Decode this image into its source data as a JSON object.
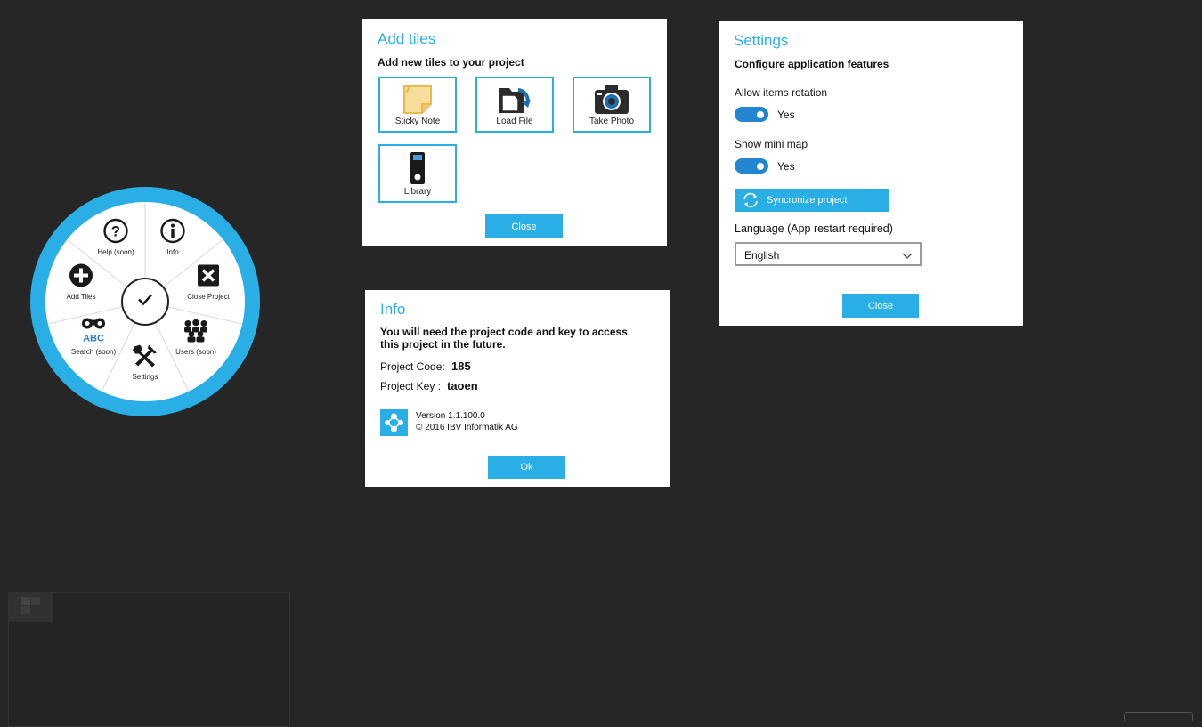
{
  "add_tiles": {
    "title": "Add tiles",
    "subtitle": "Add new tiles to your project",
    "tiles": [
      {
        "label": "Sticky Note",
        "icon": "sticky-note-icon"
      },
      {
        "label": "Load File",
        "icon": "load-file-icon"
      },
      {
        "label": "Take Photo",
        "icon": "camera-icon"
      },
      {
        "label": "Library",
        "icon": "library-binder-icon"
      }
    ],
    "close_label": "Close"
  },
  "info": {
    "title": "Info",
    "message": "You will need the project code and key to access this project in the future.",
    "code_label": "Project Code:",
    "code_value": "185",
    "key_label": "Project Key :",
    "key_value": "taoen",
    "version": "Version  1.1.100.0",
    "copyright": "© 2016 IBV Informatik AG",
    "ok_label": "Ok"
  },
  "settings": {
    "title": "Settings",
    "subtitle": "Configure application features",
    "rotation_label": "Allow items rotation",
    "rotation_value": "Yes",
    "minimap_label": "Show mini map",
    "minimap_value": "Yes",
    "sync_label": "Syncronize project",
    "language_label": "Language (App restart required)",
    "language_value": "English",
    "close_label": "Close"
  },
  "radial_menu": {
    "items": [
      {
        "label": "Help (soon)",
        "icon": "help-icon"
      },
      {
        "label": "Info",
        "icon": "info-icon"
      },
      {
        "label": "Close Project",
        "icon": "close-project-icon"
      },
      {
        "label": "Users (soon)",
        "icon": "users-icon"
      },
      {
        "label": "Settings",
        "icon": "settings-tools-icon"
      },
      {
        "label": "Search (soon)",
        "icon": "search-binoculars-icon"
      },
      {
        "label": "Add Tiles",
        "icon": "add-icon"
      }
    ],
    "center_icon": "checkmark-icon",
    "search_icon_text": "ABC"
  },
  "colors": {
    "accent": "#29aee6",
    "background": "#262626",
    "toggle": "#2386d0"
  }
}
